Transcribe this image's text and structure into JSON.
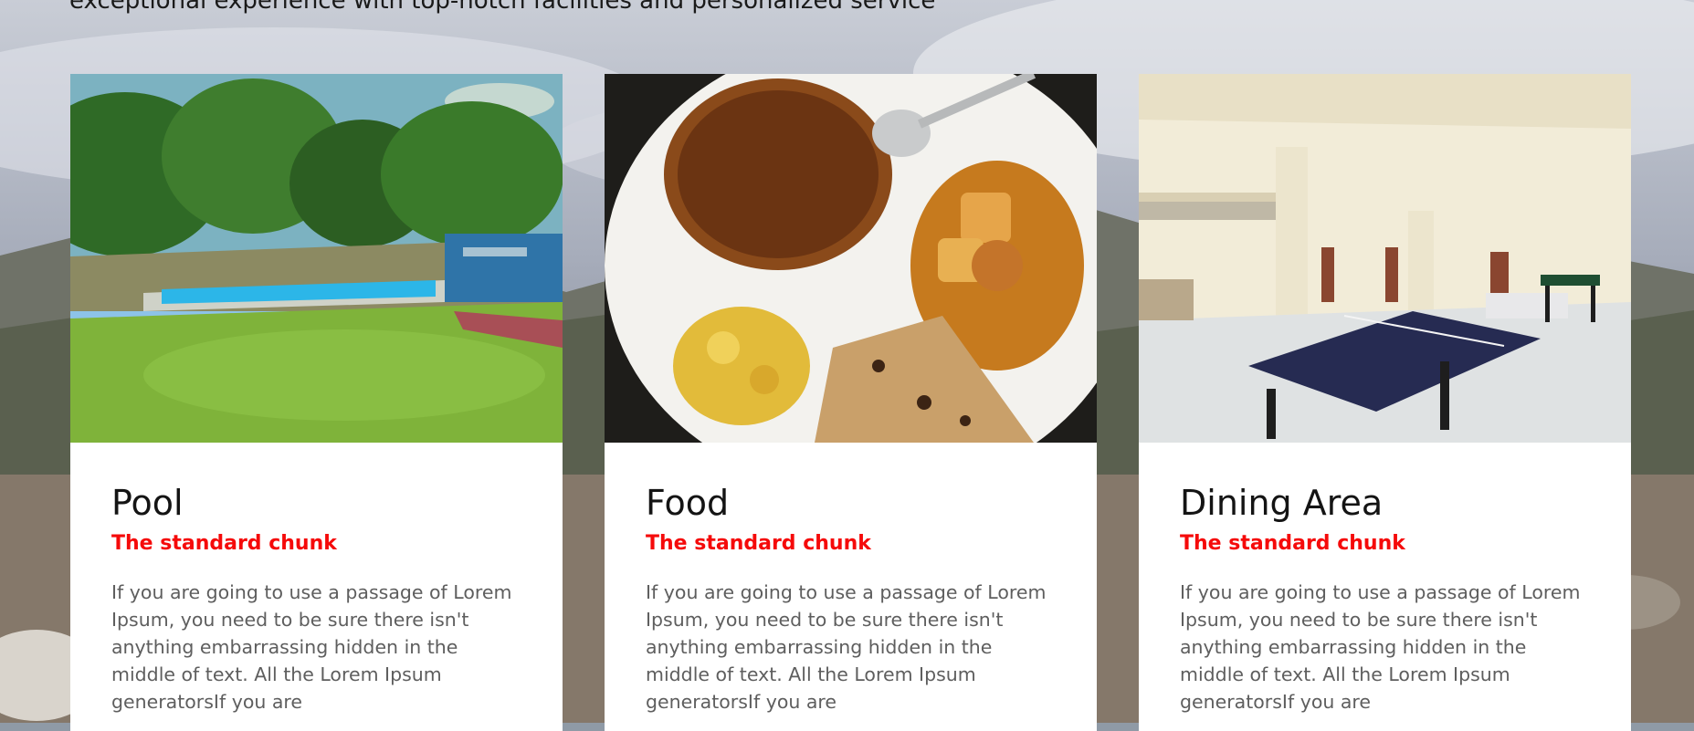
{
  "page": {
    "intro_text": "exceptional experience with top-notch facilities and personalized service"
  },
  "cards": [
    {
      "title": "Pool",
      "subtitle": "The standard chunk",
      "description": "If you are going to use a passage of Lorem Ipsum, you need to be sure there isn't anything embarrassing hidden in the middle of text. All the Lorem Ipsum generatorsIf you are",
      "image_icon": "pool-photo"
    },
    {
      "title": "Food",
      "subtitle": "The standard chunk",
      "description": "If you are going to use a passage of Lorem Ipsum, you need to be sure there isn't anything embarrassing hidden in the middle of text. All the Lorem Ipsum generatorsIf you are",
      "image_icon": "food-photo"
    },
    {
      "title": "Dining Area",
      "subtitle": "The standard chunk",
      "description": "If you are going to use a passage of Lorem Ipsum, you need to be sure there isn't anything embarrassing hidden in the middle of text. All the Lorem Ipsum generatorsIf you are",
      "image_icon": "dining-area-photo"
    }
  ],
  "colors": {
    "accent": "#f50a0a",
    "title": "#141414",
    "body_text": "#5e5e5e",
    "card_bg": "#ffffff"
  }
}
